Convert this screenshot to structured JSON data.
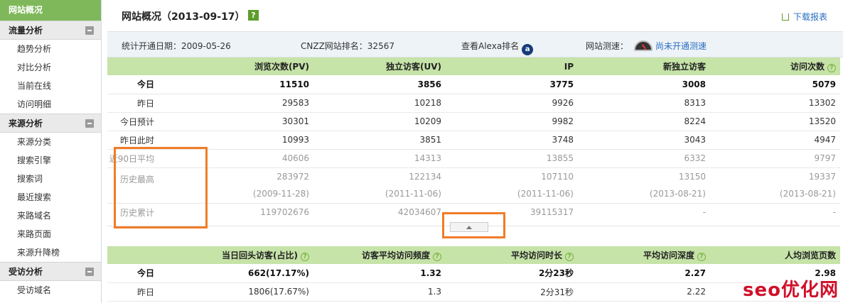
{
  "sidebar": {
    "active": "网站概况",
    "groups": [
      {
        "label": "流量分析",
        "items": [
          "趋势分析",
          "对比分析",
          "当前在线",
          "访问明细"
        ]
      },
      {
        "label": "来源分析",
        "items": [
          "来源分类",
          "搜索引擎",
          "搜索词",
          "最近搜索",
          "来路域名",
          "来路页面",
          "来源升降榜"
        ]
      },
      {
        "label": "受访分析",
        "items": [
          "受访域名"
        ]
      }
    ]
  },
  "header": {
    "title": "网站概况（2013-09-17）",
    "help": "?",
    "download": "下载报表"
  },
  "info": {
    "start_date": "统计开通日期：2009-05-26",
    "cnzz_rank": "CNZZ网站排名：32567",
    "alexa": "查看Alexa排名",
    "alexa_icon_text": "a",
    "speed_label": "网站测速：",
    "speed_link": "尚未开通测速"
  },
  "table1": {
    "headers": [
      "",
      "浏览次数(PV)",
      "独立访客(UV)",
      "IP",
      "新独立访客",
      "访问次数"
    ],
    "rows": [
      [
        "今日",
        "11510",
        "3856",
        "3775",
        "3008",
        "5079"
      ],
      [
        "昨日",
        "29583",
        "10218",
        "9926",
        "8313",
        "13302"
      ],
      [
        "今日预计",
        "30301",
        "10209",
        "9982",
        "8224",
        "13520"
      ],
      [
        "昨日此时",
        "10993",
        "3851",
        "3748",
        "3043",
        "4947"
      ],
      [
        "近90日平均",
        "40606",
        "14313",
        "13855",
        "6332",
        "9797"
      ],
      [
        "历史最高",
        "283972",
        "122134",
        "107110",
        "13150",
        "19337"
      ],
      [
        "",
        "(2009-11-28)",
        "(2011-11-06)",
        "(2011-11-06)",
        "(2013-08-21)",
        "(2013-08-21)"
      ],
      [
        "历史累计",
        "119702676",
        "42034607",
        "39115317",
        "-",
        "-"
      ]
    ]
  },
  "table2": {
    "headers": [
      "",
      "当日回头访客(占比)",
      "访客平均访问频度",
      "平均访问时长",
      "平均访问深度",
      "人均浏览页数"
    ],
    "rows": [
      [
        "今日",
        "662(17.17%)",
        "1.32",
        "2分23秒",
        "2.27",
        "2.98"
      ],
      [
        "昨日",
        "1806(17.67%)",
        "1.3",
        "2分31秒",
        "2.22",
        ""
      ]
    ]
  },
  "watermark": "seo优化网"
}
